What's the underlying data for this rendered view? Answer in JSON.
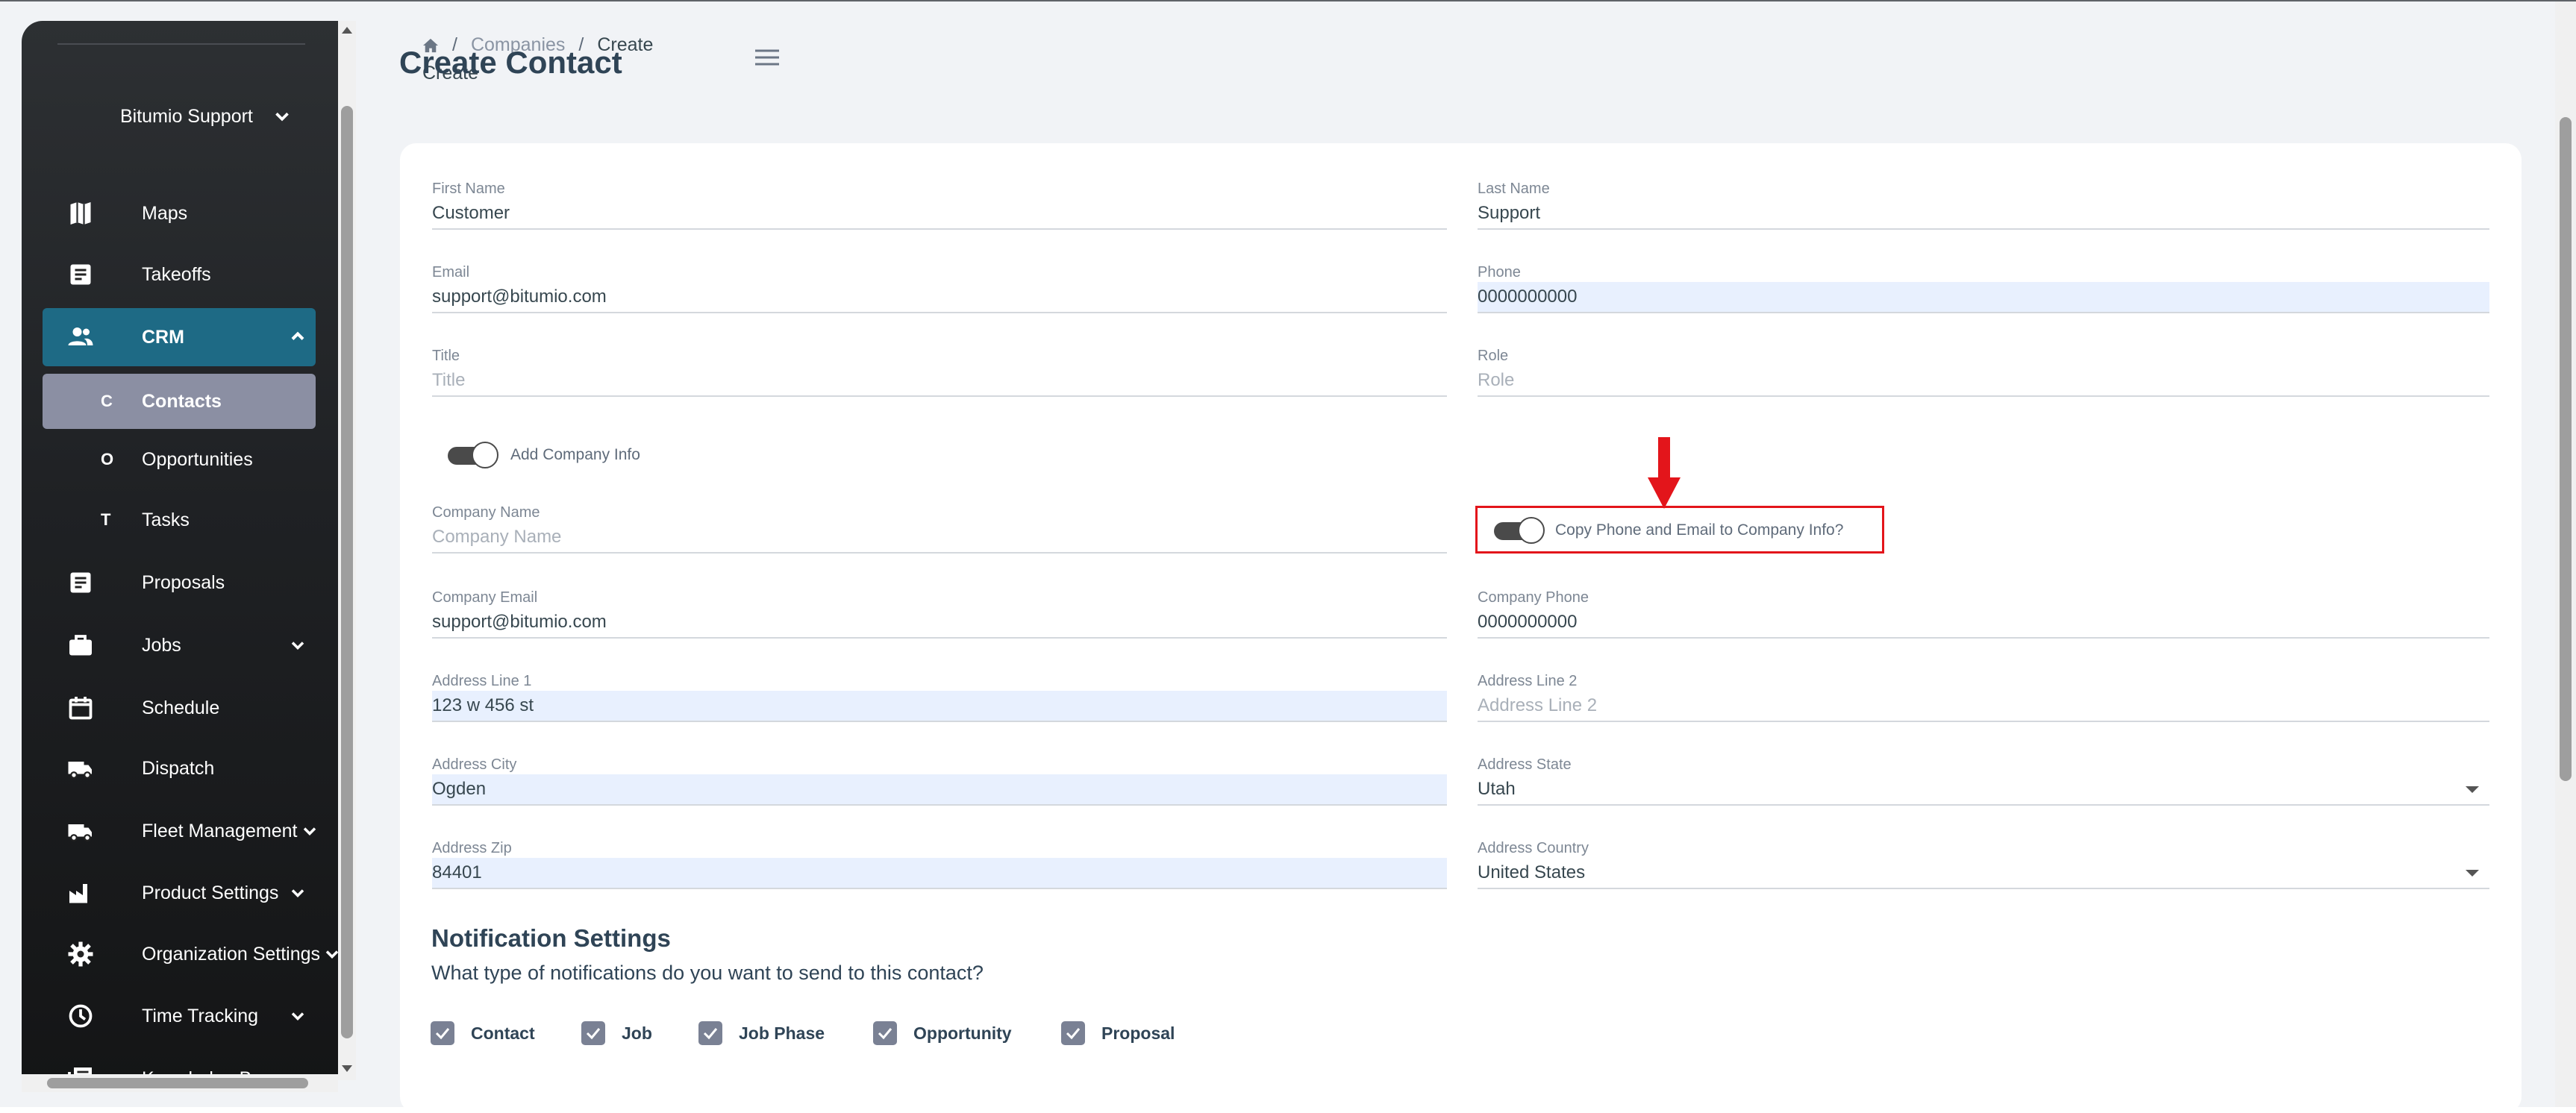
{
  "sidebar": {
    "user": "Bitumio Support",
    "items": [
      {
        "label": "Maps",
        "icon": "map-icon"
      },
      {
        "label": "Takeoffs",
        "icon": "document-icon"
      },
      {
        "label": "CRM",
        "icon": "people-icon"
      },
      {
        "label": "Contacts",
        "letter": "C"
      },
      {
        "label": "Opportunities",
        "letter": "O"
      },
      {
        "label": "Tasks",
        "letter": "T"
      },
      {
        "label": "Proposals",
        "icon": "document-icon"
      },
      {
        "label": "Jobs",
        "icon": "briefcase-icon"
      },
      {
        "label": "Schedule",
        "icon": "calendar-icon"
      },
      {
        "label": "Dispatch",
        "icon": "truck-icon"
      },
      {
        "label": "Fleet Management",
        "icon": "truck-icon"
      },
      {
        "label": "Product Settings",
        "icon": "factory-icon"
      },
      {
        "label": "Organization Settings",
        "icon": "gear-icon"
      },
      {
        "label": "Time Tracking",
        "icon": "clock-icon"
      },
      {
        "label": "Knowledge Base",
        "icon": "book-icon"
      }
    ]
  },
  "header": {
    "breadcrumb": {
      "sep": "/",
      "link": "Companies",
      "current": "Create"
    },
    "title": "Create Contact",
    "title_overlap": "Create"
  },
  "form": {
    "first_name": {
      "label": "First Name",
      "value": "Customer"
    },
    "last_name": {
      "label": "Last Name",
      "value": "Support"
    },
    "email": {
      "label": "Email",
      "value": "support@bitumio.com"
    },
    "phone": {
      "label": "Phone",
      "value": "0000000000"
    },
    "title": {
      "label": "Title",
      "placeholder": "Title"
    },
    "role": {
      "label": "Role",
      "placeholder": "Role"
    },
    "add_company_info": {
      "label": "Add Company Info",
      "on": true
    },
    "copy_phone_email": {
      "label": "Copy Phone and Email to Company Info?",
      "on": true
    },
    "company_name": {
      "label": "Company Name",
      "placeholder": "Company Name"
    },
    "company_email": {
      "label": "Company Email",
      "value": "support@bitumio.com"
    },
    "company_phone": {
      "label": "Company Phone",
      "value": "0000000000"
    },
    "address_line1": {
      "label": "Address Line 1",
      "value": "123 w 456 st"
    },
    "address_line2": {
      "label": "Address Line 2",
      "placeholder": "Address Line 2"
    },
    "address_city": {
      "label": "Address City",
      "value": "Ogden"
    },
    "address_state": {
      "label": "Address State",
      "value": "Utah"
    },
    "address_zip": {
      "label": "Address Zip",
      "value": "84401"
    },
    "address_country": {
      "label": "Address Country",
      "value": "United States"
    }
  },
  "notifications": {
    "title": "Notification Settings",
    "subtitle": "What type of notifications do you want to send to this contact?",
    "options": [
      {
        "label": "Contact",
        "checked": true
      },
      {
        "label": "Job",
        "checked": true
      },
      {
        "label": "Job Phase",
        "checked": true
      },
      {
        "label": "Opportunity",
        "checked": true
      },
      {
        "label": "Proposal",
        "checked": true
      }
    ]
  },
  "colors": {
    "accent": "#1e6a85",
    "highlight": "#e3151b",
    "checkbox": "#7a8194"
  }
}
